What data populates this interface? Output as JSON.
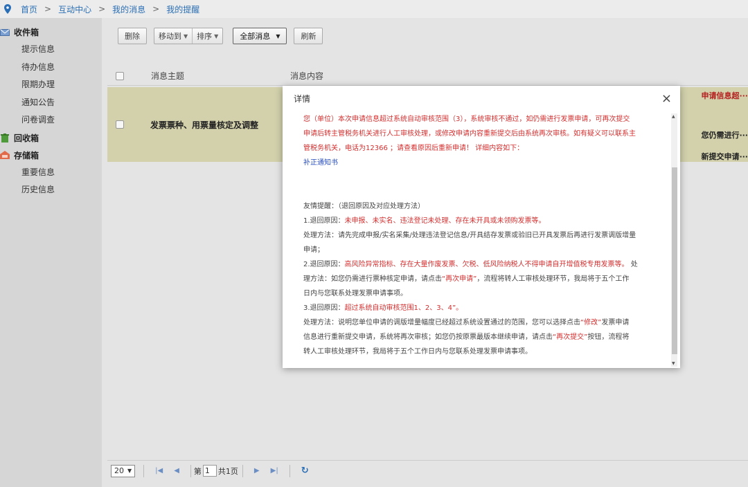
{
  "breadcrumb": {
    "home": "首页",
    "sep": ">",
    "interact": "互动中心",
    "my_msg": "我的消息",
    "my_remind": "我的提醒"
  },
  "sidebar": {
    "inbox": "收件箱",
    "inbox_items": [
      "提示信息",
      "待办信息",
      "限期办理",
      "通知公告",
      "问卷调查"
    ],
    "recycle": "回收箱",
    "storage": "存储箱",
    "storage_items": [
      "重要信息",
      "历史信息"
    ]
  },
  "toolbar": {
    "delete": "删除",
    "move_to": "移动到",
    "sort": "排序",
    "all_msg": "全部消息",
    "refresh": "刷新"
  },
  "table": {
    "col_subject": "消息主题",
    "col_content": "消息内容",
    "row_subject": "发票票种、用票量核定及调整",
    "right_fragments": [
      "申请信息超···",
      "您仍需进行···",
      "新提交申请···"
    ]
  },
  "pager": {
    "page_size": "20",
    "page_prefix": "第",
    "page_value": "1",
    "total": "共1页"
  },
  "modal": {
    "title": "详情",
    "close": "×",
    "p1": "您（单位）本次申请信息超过系统自动审核范围（3），系统审核不通过，如仍需进行发票申请，可再次提交",
    "p2": "申请后转主管税务机关进行人工审核处理，或修改申请内容重新提交后由系统再次审核。如有疑义可以联系主",
    "p3": "管税务机关，电话为12366 ；请查看原因后重新申请！ 详细内容如下：",
    "link": "补正通知书",
    "tip": "友情提醒：（退回原因及对应处理方法）",
    "r1_label": "1.退回原因：",
    "r1_reason": "未申报、未实名、违法登记未处理、存在未开具或未领购发票等。",
    "r1_method_a": "处理方法：请先完成申报/实名采集/处理违法登记信息/开具结存发票或验旧已开具发票后再进行发票调版增量",
    "r1_method_b": "申请；",
    "r2_label": "2.退回原因：",
    "r2_reason": "高风险异常指标、存在大量作废发票、欠税、低风险纳税人不得申请自开增值税专用发票等。",
    "r2_tail": " 处",
    "r2_method_a": "理方法：如您仍需进行票种核定申请，请点击",
    "r2_quote": "“再次申请”",
    "r2_method_b": "，流程将转人工审核处理环节，我局将于五个工作",
    "r2_method_c": "日内与您联系处理发票申请事项。",
    "r3_label": "3.退回原因：",
    "r3_reason": "超过系统自动审核范围1、2、3、4”。",
    "r3_method_a": "处理方法：说明您单位申请的调版增量幅度已经超过系统设置通过的范围，您可以选择点击",
    "r3_quote1": "“修改”",
    "r3_method_b": "发票申请",
    "r3_method_c": "信息进行重新提交申请，系统将再次审核；如您仍按原票最版本继续申请，请点击",
    "r3_quote2": "“再次提交”",
    "r3_method_d": "按钮，流程将",
    "r3_method_e": "转人工审核处理环节，我局将于五个工作日内与您联系处理发票申请事项。"
  },
  "colors": {
    "accent": "#2a6fb5",
    "highlight_row": "#d2d1ac",
    "warning_text": "#d32f2f"
  }
}
